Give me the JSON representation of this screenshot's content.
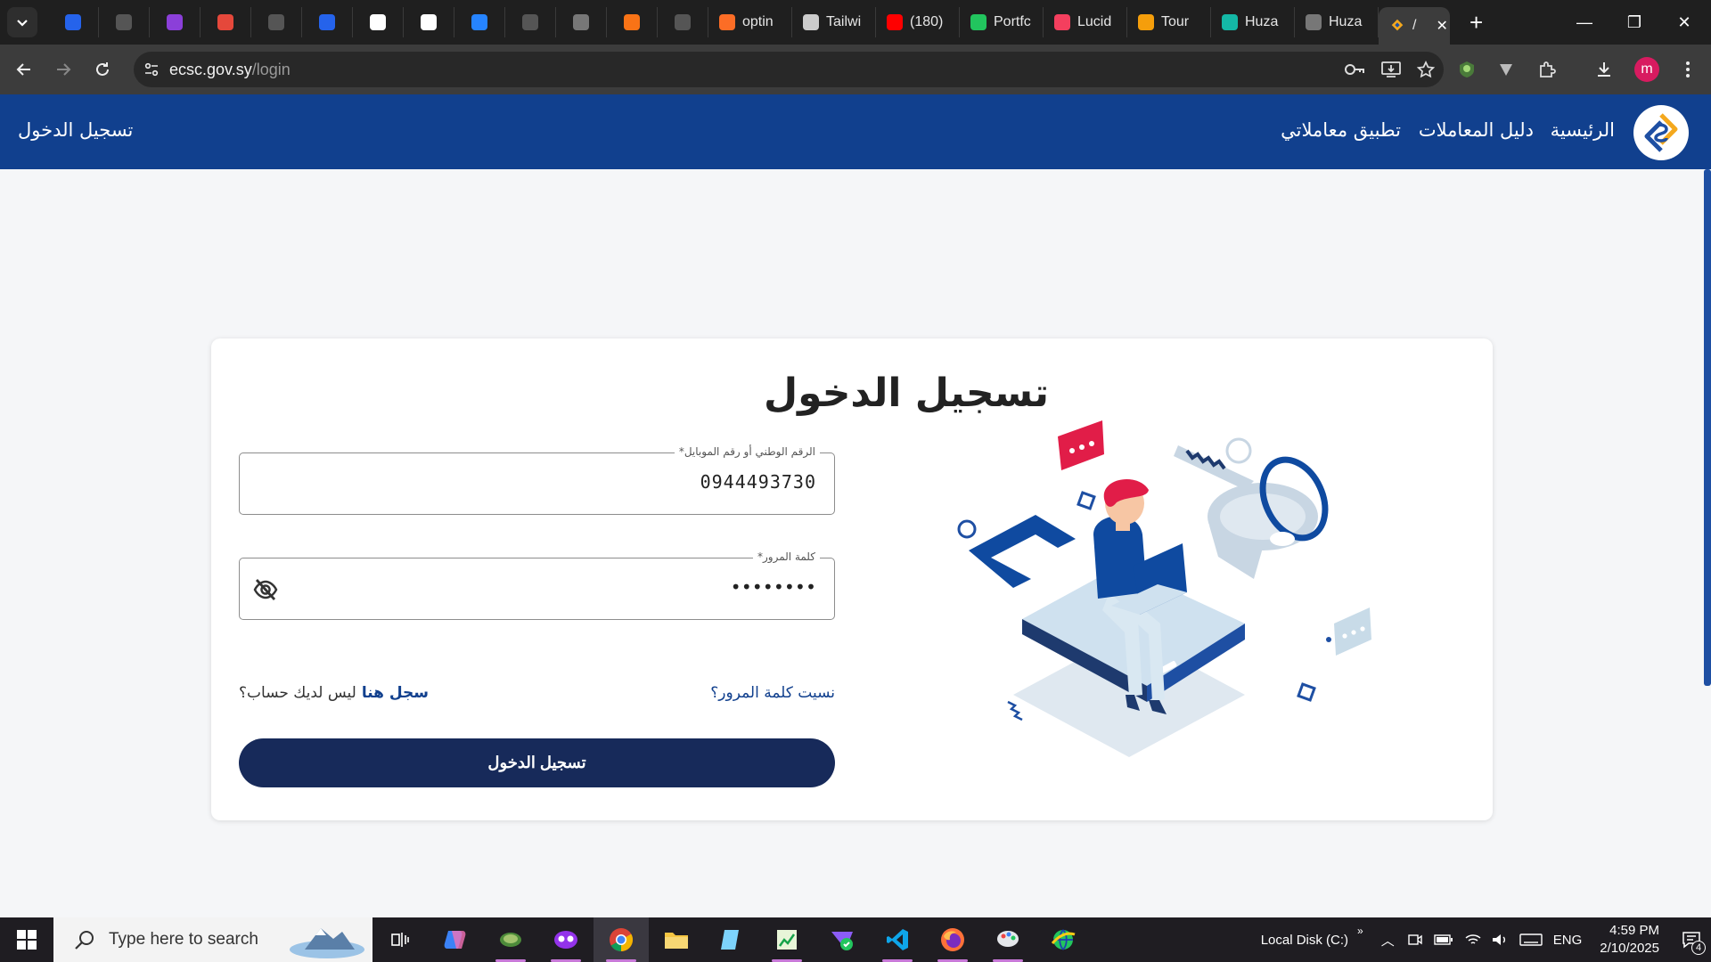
{
  "browser": {
    "tabs": [
      {
        "label": "",
        "icon": "aws-icon",
        "color": "#2563eb"
      },
      {
        "label": "",
        "icon": "github-icon",
        "color": "#555555"
      },
      {
        "label": "",
        "icon": "shield-icon",
        "color": "#8b3fd9"
      },
      {
        "label": "",
        "icon": "stack-icon",
        "color": "#e5483b"
      },
      {
        "label": "",
        "icon": "github-icon",
        "color": "#555555"
      },
      {
        "label": "",
        "icon": "blue-circle-icon",
        "color": "#2563eb"
      },
      {
        "label": "",
        "icon": "grid-icon",
        "color": "#ffffff"
      },
      {
        "label": "",
        "icon": "google-icon",
        "color": "#ffffff"
      },
      {
        "label": "",
        "icon": "jira-icon",
        "color": "#2684ff"
      },
      {
        "label": "",
        "icon": "pen-icon",
        "color": "#555555"
      },
      {
        "label": "",
        "icon": "globe-icon",
        "color": "#777777"
      },
      {
        "label": "",
        "icon": "apps-icon",
        "color": "#f97316"
      },
      {
        "label": "",
        "icon": "link-icon",
        "color": "#555555"
      },
      {
        "label": "optin",
        "icon": "gitlab-icon",
        "color": "#fc6d26"
      },
      {
        "label": "Tailwi",
        "icon": "tailwind-icon",
        "color": "#cccccc"
      },
      {
        "label": "(180)",
        "icon": "youtube-icon",
        "color": "#ff0000"
      },
      {
        "label": "Portfc",
        "icon": "portfolio-icon",
        "color": "#22c55e"
      },
      {
        "label": "Lucid",
        "icon": "lucid-icon",
        "color": "#f43f5e"
      },
      {
        "label": "Tour",
        "icon": "tour-icon",
        "color": "#f59e0b"
      },
      {
        "label": "Huza",
        "icon": "hubspot-icon",
        "color": "#14b8a6"
      },
      {
        "label": "Huza",
        "icon": "globe-icon",
        "color": "#777777"
      }
    ],
    "active_tab": {
      "label": "/",
      "icon": "ecsc-icon"
    },
    "url_host": "ecsc.gov.sy",
    "url_path": "/login",
    "profile_initial": "m"
  },
  "site": {
    "nav": {
      "home": "الرئيسية",
      "guide": "دليل المعاملات",
      "app": "تطبيق معاملاتي",
      "login": "تسجيل الدخول"
    },
    "form": {
      "title": "تسجيل الدخول",
      "id_label": "الرقم الوطني أو رقم الموبايل*",
      "id_value": "0944493730",
      "password_label": "كلمة المرور*",
      "password_value": "••••••••",
      "forgot": "نسيت كلمة المرور؟",
      "no_account": "ليس لديك حساب؟",
      "register": "سجل هنا",
      "submit": "تسجيل الدخول"
    },
    "colors": {
      "header": "#11408e",
      "button": "#172a5a",
      "accent": "#e11d48"
    }
  },
  "taskbar": {
    "search_placeholder": "Type here to search",
    "drive_label": "Local Disk (C:)",
    "language": "ENG",
    "time": "4:59 PM",
    "date": "2/10/2025",
    "notifications": "4"
  }
}
